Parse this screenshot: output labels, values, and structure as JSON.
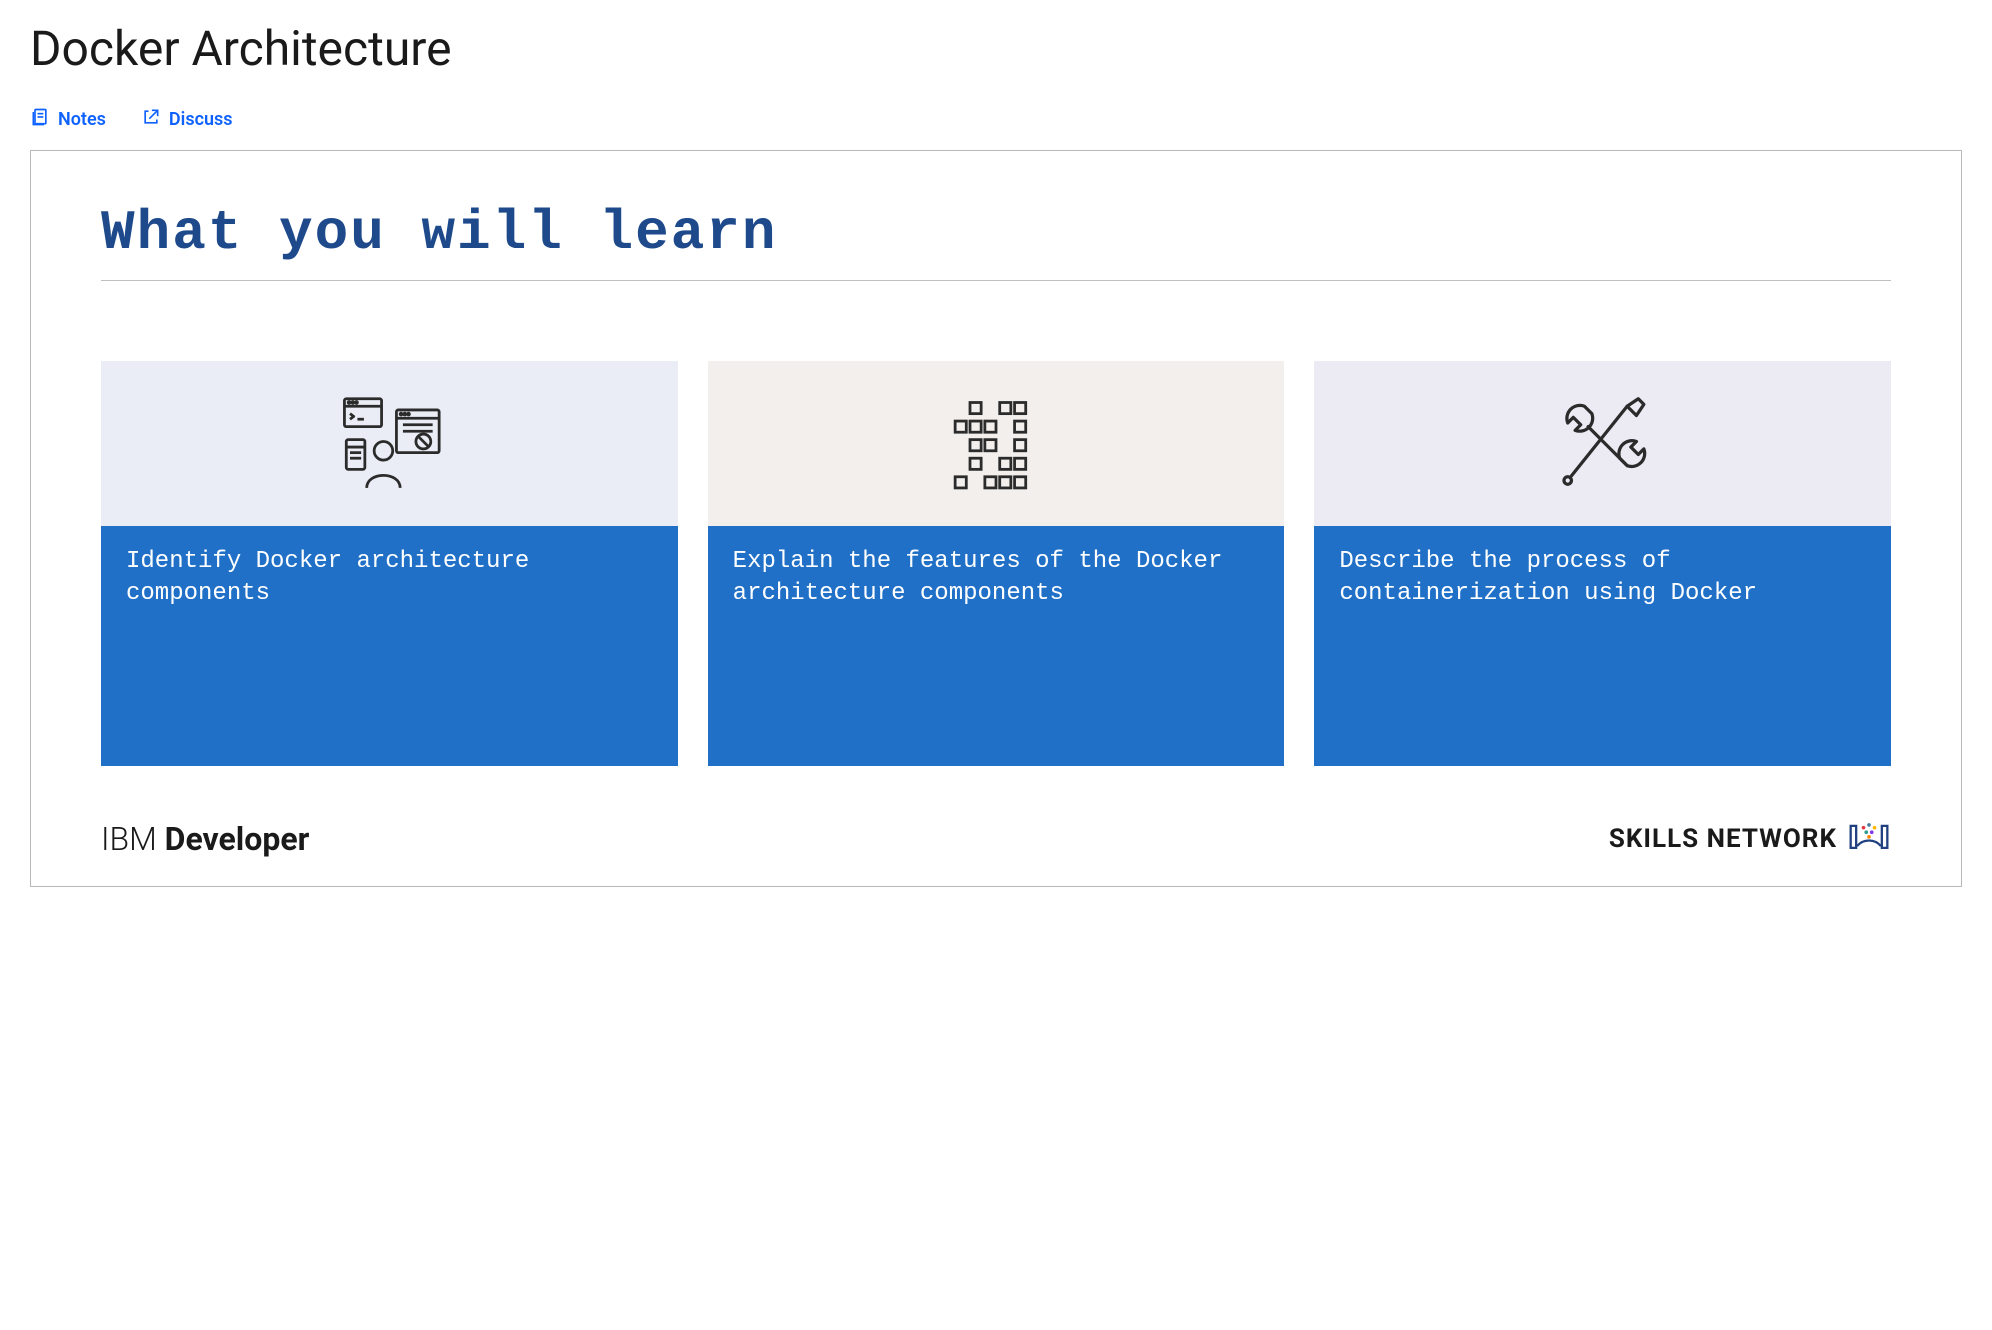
{
  "page": {
    "title": "Docker Architecture"
  },
  "actions": {
    "notes": "Notes",
    "discuss": "Discuss"
  },
  "slide": {
    "heading": "What you will learn",
    "cards": [
      {
        "text": "Identify Docker architecture components"
      },
      {
        "text": "Explain the features of the Docker architecture components"
      },
      {
        "text": "Describe the process of containerization using Docker"
      }
    ],
    "footer": {
      "left_light": "IBM ",
      "left_bold": "Developer",
      "right": "SKILLS NETWORK"
    }
  }
}
